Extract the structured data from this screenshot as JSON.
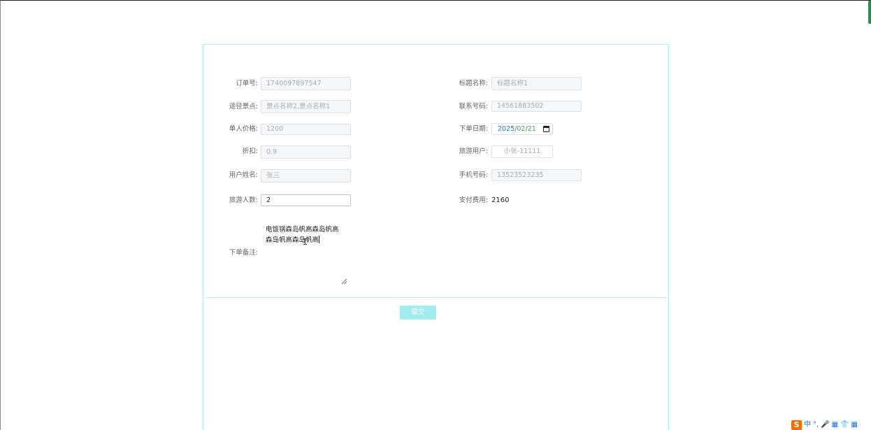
{
  "form": {
    "order_number": {
      "label": "订单号:",
      "value": "1740097897547"
    },
    "title_name": {
      "label": "标题名称:",
      "value": "标题名称1"
    },
    "route_spots": {
      "label": "途径景点:",
      "value": "景点名称2,景点名称1"
    },
    "contact_phone": {
      "label": "联系号码:",
      "value": "14561883502"
    },
    "unit_price": {
      "label": "单人价格:",
      "value": "1200"
    },
    "order_date": {
      "label": "下单日期:",
      "year": "2025",
      "month": "02",
      "day": "21",
      "separator": "/"
    },
    "discount": {
      "label": "折扣:",
      "value": "0.9"
    },
    "travel_user": {
      "label": "旅游用户:",
      "value": "小张-11111"
    },
    "user_name": {
      "label": "用户姓名:",
      "value": "张三"
    },
    "mobile": {
      "label": "手机号码:",
      "value": "13523523235"
    },
    "traveler_count": {
      "label": "旅游人数:",
      "value": "2"
    },
    "payment": {
      "label": "支付费用:",
      "value": "2160"
    },
    "remark": {
      "label": "下单备注:",
      "value": "电饭锅森岛帆高森岛帆高森岛帆高森岛帆高"
    },
    "submit_label": "提交"
  },
  "tray": {
    "logo": "S",
    "items": [
      "中",
      "°,",
      "🎤",
      "▦",
      "👕",
      "▦"
    ]
  },
  "colors": {
    "accent": "#a0ecef",
    "border": "#b9ecef",
    "date_year": "#2f7fbf",
    "date_month_day": "#46a35b",
    "tray_logo": "#ff6a00"
  }
}
